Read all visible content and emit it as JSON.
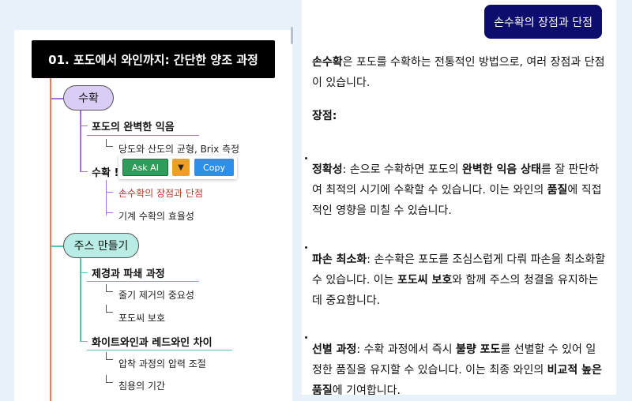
{
  "mindmap": {
    "root_title": "01. 포도에서 와인까지: 간단한 양조 과정",
    "branches": [
      {
        "label": "수확",
        "subs": [
          {
            "label": "포도의 완벽한 익음",
            "leaves": [
              "당도와 산도의 균형, Brix 측정"
            ]
          },
          {
            "label": "수확 방법",
            "leaves": [
              "손수확의 장점과 단점",
              "기계 수확의 효율성"
            ]
          }
        ]
      },
      {
        "label": "주스 만들기",
        "subs": [
          {
            "label": "제경과 파쇄 과정",
            "leaves": [
              "줄기 제거의 중요성",
              "포도씨 보호"
            ]
          },
          {
            "label": "화이트와인과 레드와인 차이",
            "leaves": [
              "압착 과정의 압력 조절",
              "침용의 기간"
            ]
          }
        ]
      }
    ],
    "sub2_visible": "수확 !",
    "colors": {
      "spine": "#f07a52",
      "branch1_fill": "#d9ccf5",
      "branch1_line": "#a76fd8",
      "branch2_fill": "#b8ece4",
      "branch2_line": "#55c4b4",
      "active_leaf": "#c0392b"
    }
  },
  "toolbar": {
    "ask_ai": "Ask AI",
    "arrow": "▼",
    "copy": "Copy"
  },
  "chat": {
    "user_message": "손수확의 장점과 단점",
    "intro_bold": "손수확",
    "intro_rest": "은 포도를 수확하는 전통적인 방법으로, 여러 장점과 단점이 있습니다.",
    "section_heading": "장점:",
    "points": [
      {
        "title": "정확성",
        "pre": ": 손으로 수확하면 포도의 ",
        "b1": "완벽한 익음 상태",
        "mid": "를 잘 판단하여 최적의 시기에 수확할 수 있습니다. 이는 와인의 ",
        "b2": "품질",
        "post": "에 직접적인 영향을 미칠 수 있습니다."
      },
      {
        "title": "파손 최소화",
        "pre": ": 손수확은 포도를 조심스럽게 다뤄 파손을 최소화할 수 있습니다. 이는 ",
        "b1": "포도씨 보호",
        "mid": "와 함께 주스의 청결을 유지하는 데 중요합니다.",
        "b2": "",
        "post": ""
      },
      {
        "title": "선별 과정",
        "pre": ": 수확 과정에서 즉시 ",
        "b1": "불량 포도",
        "mid": "를 선별할 수 있어 일정한 품질을 유지할 수 있습니다. 이는 최종 와인의 ",
        "b2": "비교적 높은 품질",
        "post": "에 기여합니다."
      }
    ]
  }
}
